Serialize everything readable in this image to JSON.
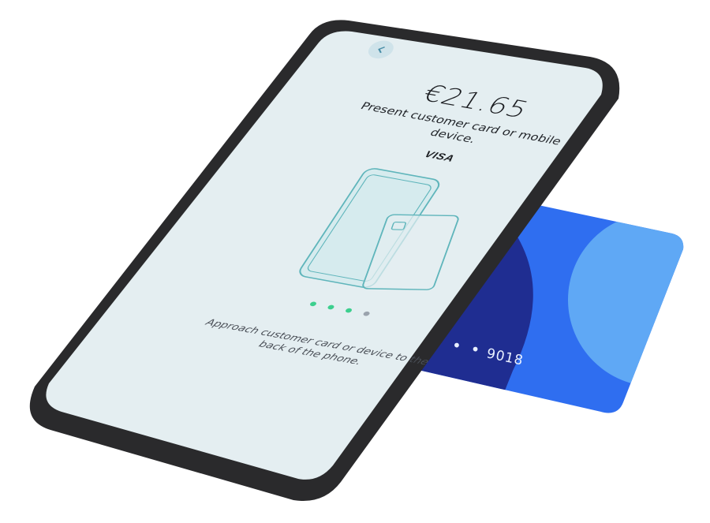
{
  "payment": {
    "amount": "€21.65",
    "instruction": "Present customer card or mobile device.",
    "card_brand": "VISA",
    "hint": "Approach customer card or device to the back of the phone."
  },
  "navigation": {
    "back_icon": "chevron-left-icon"
  },
  "pager": {
    "total": 4,
    "active_count": 3
  },
  "card": {
    "masked_prefix": "• • •",
    "last_digits": "9018"
  },
  "colors": {
    "screen_bg": "#e4eef1",
    "phone_frame": "#2a2a2c",
    "accent_green": "#3ccf8e",
    "pager_inactive": "#9aa3ad",
    "illustration_stroke": "#5fb5bb",
    "card_primary": "#2f6ef0",
    "card_dark": "#1d2a8a",
    "card_light": "#5fa8f5"
  }
}
